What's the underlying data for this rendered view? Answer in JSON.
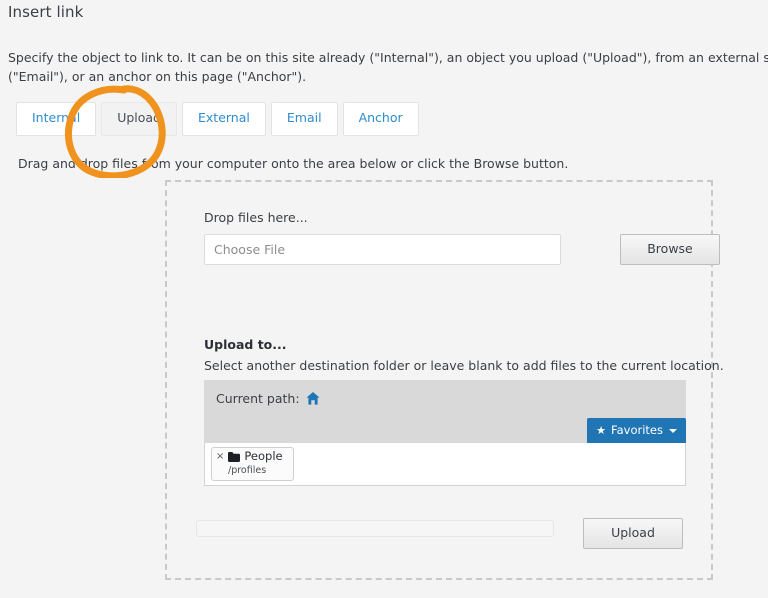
{
  "page": {
    "title": "Insert link",
    "intro_line1": "Specify the object to link to. It can be on this site already (\"Internal\"), an object you upload (\"Upload\"), from an external site (\"External\"), an em",
    "intro_line2": "(\"Email\"), or an anchor on this page (\"Anchor\")."
  },
  "tabs": {
    "items": [
      {
        "label": "Internal",
        "active": false
      },
      {
        "label": "Upload",
        "active": true
      },
      {
        "label": "External",
        "active": false
      },
      {
        "label": "Email",
        "active": false
      },
      {
        "label": "Anchor",
        "active": false
      }
    ]
  },
  "annotation": {
    "shape": "hand-drawn-ellipse",
    "target": "Upload",
    "color": "#f0921e"
  },
  "upload": {
    "instruction": "Drag and drop files from your computer onto the area below or click the Browse button.",
    "drop_label": "Drop files here...",
    "file_input_placeholder": "Choose File",
    "file_input_value": "",
    "browse_label": "Browse",
    "upload_label": "Upload",
    "progress_percent": 0
  },
  "destination": {
    "title": "Upload to...",
    "description": "Select another destination folder or leave blank to add files to the current location.",
    "current_path_label": "Current path:",
    "current_path_icon": "home-icon",
    "favorites_label": "Favorites",
    "favorites_star": "★",
    "folders": [
      {
        "name": "People",
        "path": "/profiles",
        "remove_glyph": "×",
        "icon": "folder-icon"
      }
    ]
  },
  "colors": {
    "background": "#f4f4f4",
    "link_blue": "#2e8ccf",
    "button_blue": "#2076b5",
    "annotation_orange": "#f0921e",
    "panel_gray": "#d9d9d9",
    "dashed_border": "#c9c9c9"
  }
}
